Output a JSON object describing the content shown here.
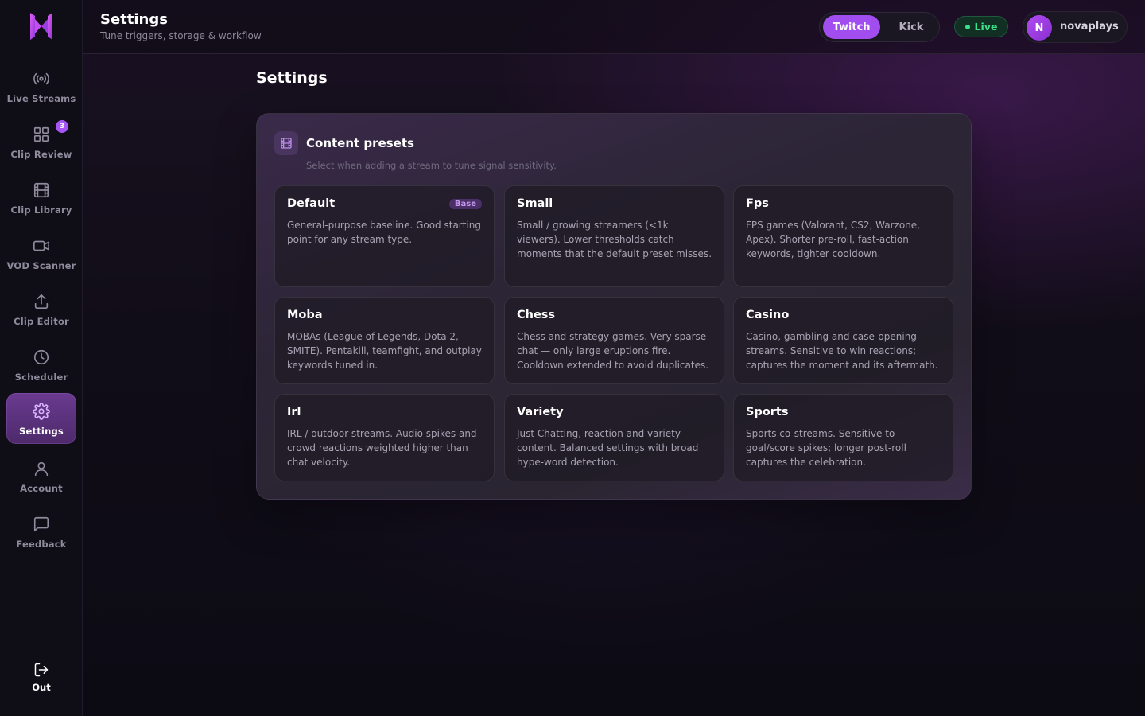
{
  "header": {
    "title": "Settings",
    "subtitle": "Tune triggers, storage & workflow",
    "platforms": [
      "Twitch",
      "Kick"
    ],
    "active_platform": "Twitch",
    "live_label": "Live",
    "user": {
      "initial": "N",
      "name": "novaplays"
    }
  },
  "sidebar": {
    "items": [
      {
        "label": "Live Streams",
        "icon": "broadcast-icon"
      },
      {
        "label": "Clip Review",
        "icon": "grid-icon",
        "badge": "3"
      },
      {
        "label": "Clip Library",
        "icon": "film-icon"
      },
      {
        "label": "VOD Scanner",
        "icon": "video-camera-icon"
      },
      {
        "label": "Clip Editor",
        "icon": "upload-icon"
      },
      {
        "label": "Scheduler",
        "icon": "clock-icon"
      },
      {
        "label": "Settings",
        "icon": "gear-icon",
        "active": true
      },
      {
        "label": "Account",
        "icon": "user-icon"
      },
      {
        "label": "Feedback",
        "icon": "message-icon"
      }
    ],
    "signout_label": "Out"
  },
  "main": {
    "section_title": "Settings",
    "panel": {
      "title": "Content presets",
      "subtitle": "Select when adding a stream to tune signal sensitivity.",
      "presets": [
        {
          "name": "Default",
          "badge": "Base",
          "description": "General-purpose baseline. Good starting point for any stream type."
        },
        {
          "name": "Small",
          "description": "Small / growing streamers (<1k viewers). Lower thresholds catch moments that the default preset misses."
        },
        {
          "name": "Fps",
          "description": "FPS games (Valorant, CS2, Warzone, Apex). Shorter pre-roll, fast-action keywords, tighter cooldown."
        },
        {
          "name": "Moba",
          "description": "MOBAs (League of Legends, Dota 2, SMITE). Pentakill, teamfight, and outplay keywords tuned in."
        },
        {
          "name": "Chess",
          "description": "Chess and strategy games. Very sparse chat — only large eruptions fire. Cooldown extended to avoid duplicates."
        },
        {
          "name": "Casino",
          "description": "Casino, gambling and case-opening streams. Sensitive to win reactions; captures the moment and its aftermath."
        },
        {
          "name": "Irl",
          "description": "IRL / outdoor streams. Audio spikes and crowd reactions weighted higher than chat velocity."
        },
        {
          "name": "Variety",
          "description": "Just Chatting, reaction and variety content. Balanced settings with broad hype-word detection."
        },
        {
          "name": "Sports",
          "description": "Sports co-streams. Sensitive to goal/score spikes; longer post-roll captures the celebration."
        }
      ]
    }
  },
  "colors": {
    "accent": "#a24df0",
    "live": "#3fe08a",
    "background": "#0e0b14"
  }
}
